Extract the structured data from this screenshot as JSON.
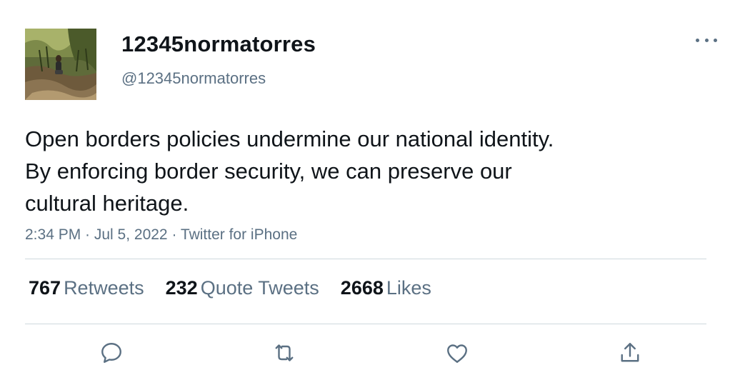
{
  "user": {
    "display_name": "12345normatorres",
    "handle": "@12345normatorres"
  },
  "tweet": {
    "text_lines": [
      "Open borders policies undermine our national identity.",
      "By enforcing border security, we can preserve our",
      "cultural heritage."
    ],
    "meta": "2:34 PM · Jul 5, 2022 · Twitter for iPhone"
  },
  "stats": {
    "retweets": {
      "count": "767",
      "label": "Retweets"
    },
    "quotes": {
      "count": "232",
      "label": "Quote Tweets"
    },
    "likes": {
      "count": "2668",
      "label": "Likes"
    }
  },
  "icons": {
    "more": "more-icon",
    "reply": "reply-icon",
    "retweet": "retweet-icon",
    "like": "like-icon",
    "share": "share-icon"
  },
  "colors": {
    "text": "#0f1419",
    "secondary": "#5b7083",
    "divider": "#cfd9de"
  }
}
